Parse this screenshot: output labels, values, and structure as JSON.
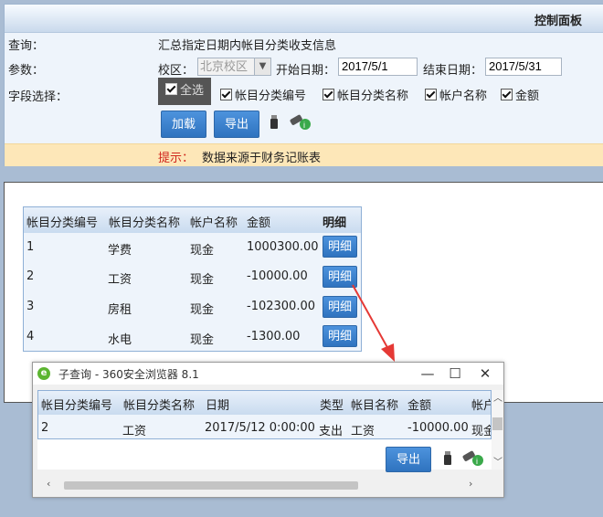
{
  "panel": {
    "title": "控制面板",
    "query_label": "查询：",
    "query_value": "汇总指定日期内帐目分类收支信息",
    "params_label": "参数：",
    "campus_label": "校区：",
    "campus_value": "北京校区",
    "start_label": "开始日期：",
    "start_value": "2017/5/1",
    "end_label": "结束日期：",
    "end_value": "2017/5/31",
    "fields_label": "字段选择：",
    "select_all": "全选",
    "fields": [
      "帐目分类编号",
      "帐目分类名称",
      "帐户名称",
      "金额"
    ],
    "load_button": "加载",
    "export_button": "导出",
    "tip_prefix": "提示：",
    "tip_text": "数据来源于财务记账表"
  },
  "main_table": {
    "headers": [
      "帐目分类编号",
      "帐目分类名称",
      "帐户名称",
      "金额",
      "明细"
    ],
    "detail_label": "明细",
    "rows": [
      {
        "code": "1",
        "name": "学费",
        "account": "现金",
        "amount": "1000300.00"
      },
      {
        "code": "2",
        "name": "工资",
        "account": "现金",
        "amount": "-10000.00"
      },
      {
        "code": "3",
        "name": "房租",
        "account": "现金",
        "amount": "-102300.00"
      },
      {
        "code": "4",
        "name": "水电",
        "account": "现金",
        "amount": "-1300.00"
      }
    ]
  },
  "child_window": {
    "title": "子查询 - 360安全浏览器 8.1",
    "headers": [
      "帐目分类编号",
      "帐目分类名称",
      "日期",
      "类型",
      "帐目名称",
      "金额",
      "帐户"
    ],
    "row": {
      "code": "2",
      "name": "工资",
      "date": "2017/5/12 0:00:00",
      "type": "支出",
      "item": "工资",
      "amount": "-10000.00",
      "account": "现金"
    },
    "export_button": "导出"
  },
  "colors": {
    "accent_button": "#3a80cf",
    "tip_bar": "#fde7b8",
    "tip_prefix": "#d0261c",
    "arrow": "#e53935"
  }
}
